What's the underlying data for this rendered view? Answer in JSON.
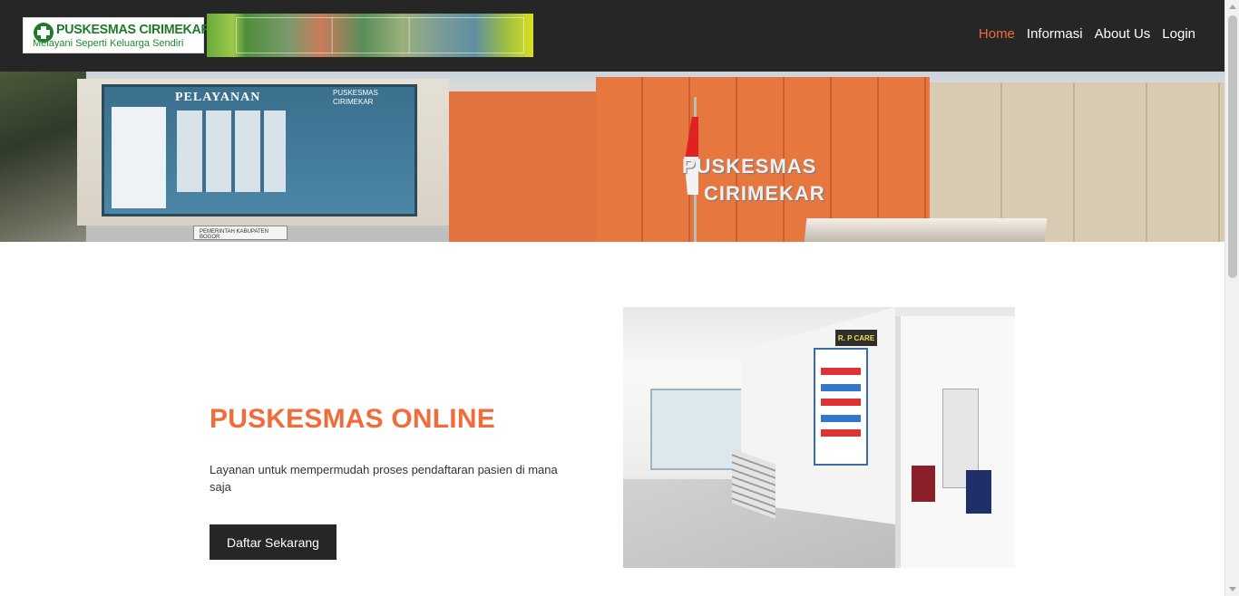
{
  "navbar": {
    "logo": {
      "title": "PUSKESMAS CIRIMEKAR",
      "tagline": "Melayani Seperti Keluarga Sendiri",
      "icon": "medical-cross-icon",
      "brand_color": "#1f7a2a"
    },
    "banner_icon": "photo-collage-banner",
    "links": [
      {
        "label": "Home",
        "active": true
      },
      {
        "label": "Informasi",
        "active": false
      },
      {
        "label": "About Us",
        "active": false
      },
      {
        "label": "Login",
        "active": false
      }
    ],
    "background_color": "#262626",
    "active_color": "#f26b3a"
  },
  "hero": {
    "board_title": "PELAYANAN",
    "board_subtitle": "PUSKESMAS CIRIMEKAR",
    "sign_line1": "PUSKESMAS",
    "sign_line2": "CIRIMEKAR",
    "plate_text": "PEMERINTAH KABUPATEN BOGOR"
  },
  "content": {
    "title": "PUSKESMAS ONLINE",
    "description": "Layanan untuk mempermudah proses pendaftaran pasien di mana saja",
    "cta_label": "Daftar Sekarang",
    "accent_color": "#f26b3a"
  },
  "photo": {
    "sign_text": "R. P CARE"
  }
}
